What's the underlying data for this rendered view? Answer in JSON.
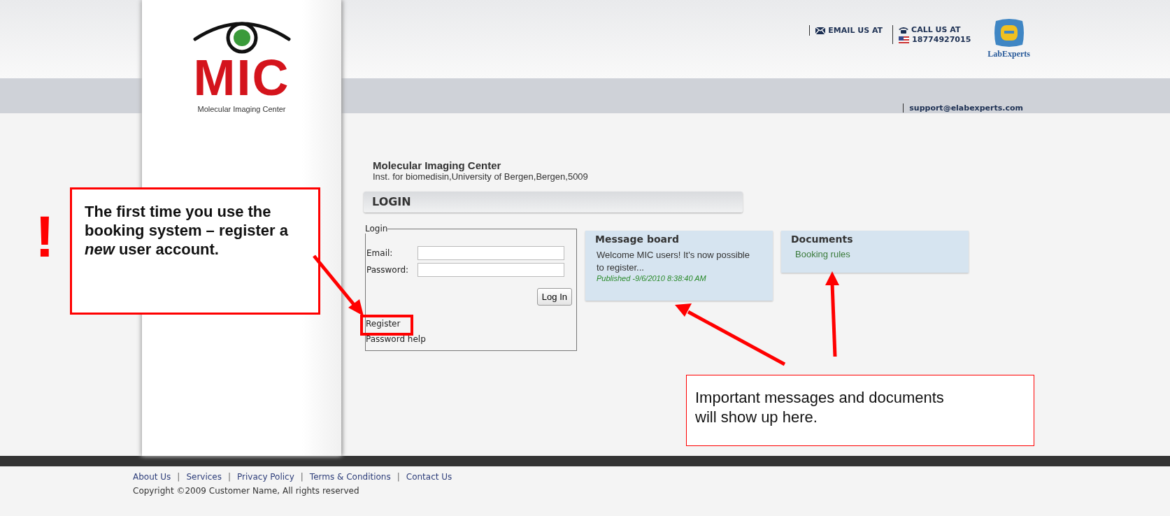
{
  "logo": {
    "title": "MIC",
    "subtitle": "Molecular Imaging Center"
  },
  "header": {
    "email_label": "EMAIL US AT",
    "call_label": "CALL US AT",
    "phone": "18774927015",
    "partner_name": "LabExperts",
    "support_email": "support@elabexperts.com"
  },
  "organization": {
    "name": "Molecular Imaging Center",
    "address": "Inst. for biomedisin,University of Bergen,Bergen,5009"
  },
  "login": {
    "heading": "LOGIN",
    "legend": "Login",
    "fields": [
      {
        "label": "Email:"
      },
      {
        "label": "Password:"
      }
    ],
    "button": "Log In",
    "links": [
      "Register",
      "Password help"
    ]
  },
  "message_board": {
    "title": "Message board",
    "messages": [
      {
        "text": "Welcome MIC users! It's now possible to register...",
        "published": "Published -9/6/2010 8:38:40 AM"
      }
    ]
  },
  "documents": {
    "title": "Documents",
    "items": [
      "Booking rules"
    ]
  },
  "footer": {
    "separator": "|",
    "links": [
      "About Us",
      "Services",
      "Privacy Policy",
      "Terms & Conditions",
      "Contact Us"
    ],
    "copyright": "Copyright ©2009 Customer Name, All rights reserved"
  },
  "annotations": {
    "mark": "!",
    "callout": "The first time you use the booking system – register a *new* user account.",
    "note": "Important messages and documents will show up here."
  }
}
